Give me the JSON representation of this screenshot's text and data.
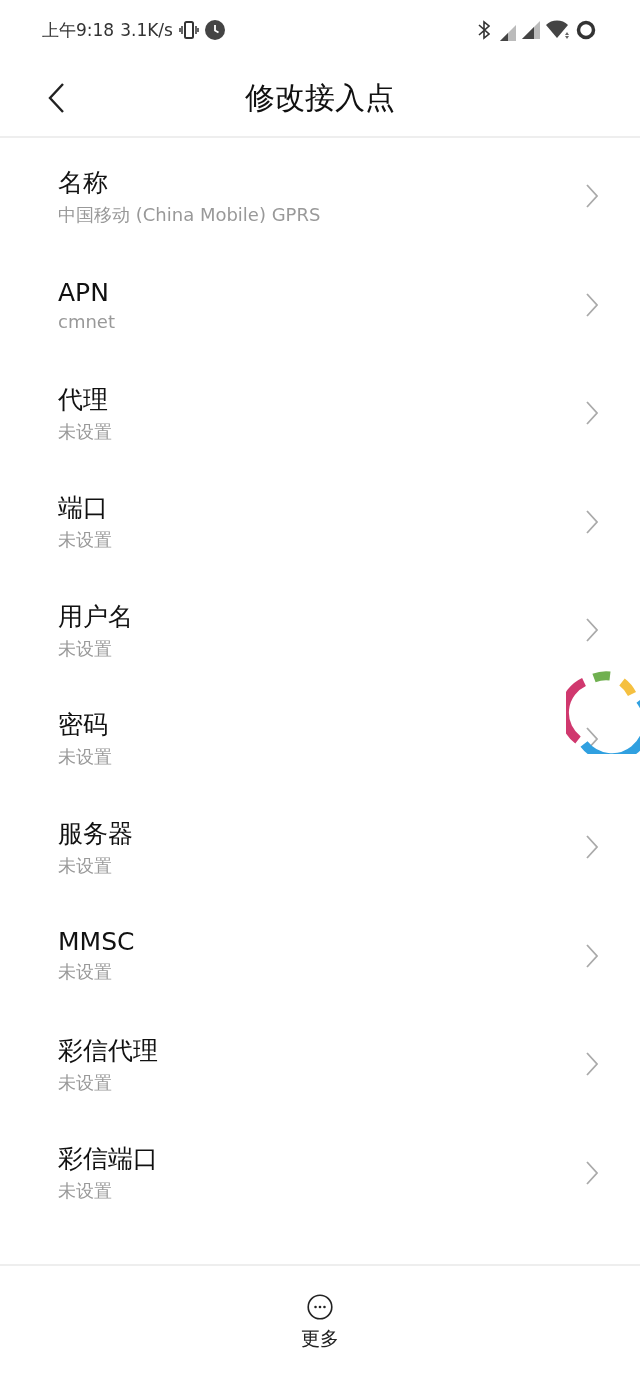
{
  "status_bar": {
    "time": "上午9:18",
    "speed": "3.1K/s"
  },
  "header": {
    "title": "修改接入点"
  },
  "settings": [
    {
      "label": "名称",
      "value": "中国移动 (China Mobile) GPRS"
    },
    {
      "label": "APN",
      "value": "cmnet"
    },
    {
      "label": "代理",
      "value": "未设置"
    },
    {
      "label": "端口",
      "value": "未设置"
    },
    {
      "label": "用户名",
      "value": "未设置"
    },
    {
      "label": "密码",
      "value": "未设置"
    },
    {
      "label": "服务器",
      "value": "未设置"
    },
    {
      "label": "MMSC",
      "value": "未设置"
    },
    {
      "label": "彩信代理",
      "value": "未设置"
    },
    {
      "label": "彩信端口",
      "value": "未设置"
    }
  ],
  "bottom_bar": {
    "more_label": "更多"
  }
}
